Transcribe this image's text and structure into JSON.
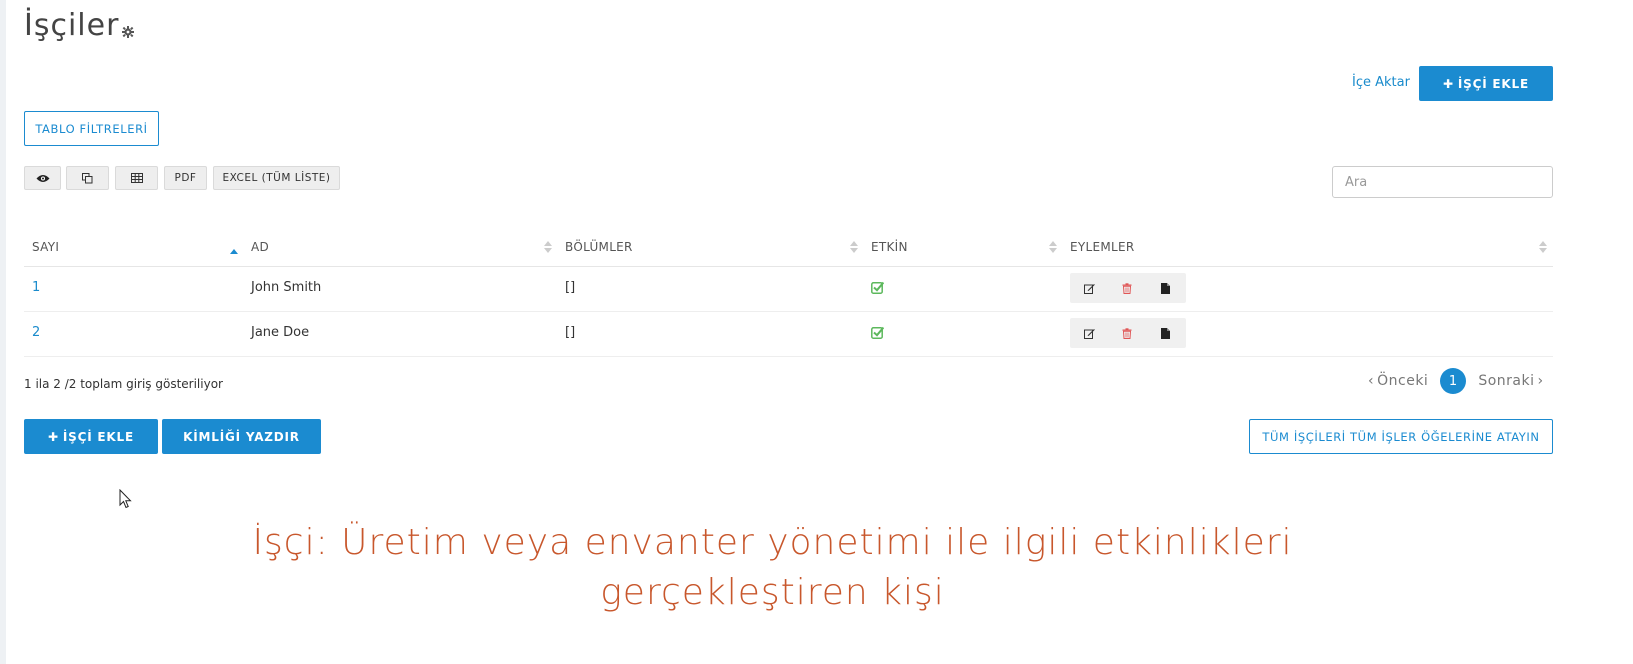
{
  "header": {
    "title": "İşçiler",
    "gear_icon": "gear-icon"
  },
  "top_actions": {
    "import_label": "İçe Aktar",
    "add_worker_label": "İŞÇİ EKLE"
  },
  "filters_button": "TABLO FİLTRELERİ",
  "toolbar": {
    "view_icon": "eye-icon",
    "copy_icon": "copy-icon",
    "csv_icon": "table-icon",
    "pdf_label": "PDF",
    "excel_label": "EXCEL (TÜM LİSTE)"
  },
  "search": {
    "placeholder": "Ara",
    "value": ""
  },
  "table": {
    "columns": [
      "SAYI",
      "AD",
      "BÖLÜMLER",
      "ETKİN",
      "EYLEMLER"
    ],
    "rows": [
      {
        "num": "1",
        "name": "John Smith",
        "sections": "[]",
        "active": true
      },
      {
        "num": "2",
        "name": "Jane Doe",
        "sections": "[]",
        "active": true
      }
    ]
  },
  "footer": {
    "info": "1 ila 2 /2 toplam giriş gösteriliyor",
    "prev_label": "Önceki",
    "page": "1",
    "next_label": "Sonraki",
    "add_worker_label": "İŞÇİ EKLE",
    "print_id_label": "KİMLİĞİ YAZDIR",
    "assign_all_label": "TÜM İŞÇİLERİ TÜM İŞLER ÖĞELERİNE ATAYIN"
  },
  "caption": {
    "line1": "İşçi: Üretim veya envanter yönetimi ile ilgili etkinlikleri",
    "line2": "gerçekleştiren kişi"
  },
  "colors": {
    "primary": "#1b8bd0",
    "caption": "#c8572c",
    "check": "#5cb85c",
    "delete": "#e05555"
  }
}
